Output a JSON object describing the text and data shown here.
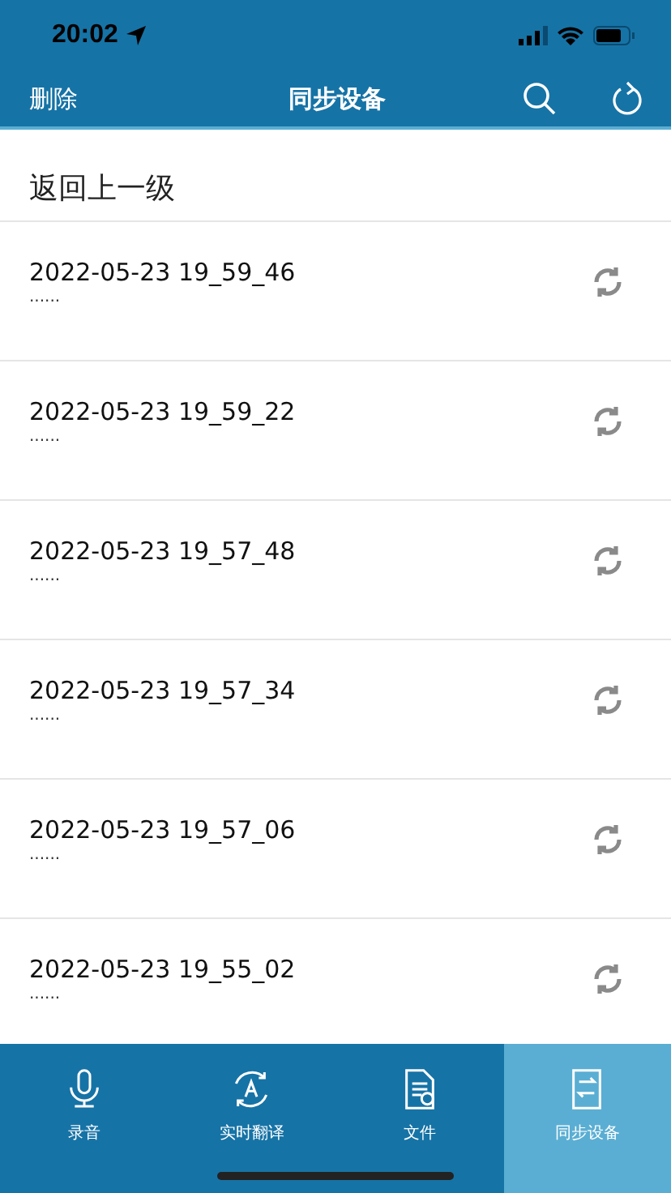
{
  "status_bar": {
    "time": "20:02"
  },
  "nav_bar": {
    "left_action": "删除",
    "title": "同步设备"
  },
  "back_link": "返回上一级",
  "recordings": [
    {
      "name": "2022-05-23 19_59_46",
      "detail": "......"
    },
    {
      "name": "2022-05-23 19_59_22",
      "detail": "......"
    },
    {
      "name": "2022-05-23 19_57_48",
      "detail": "......"
    },
    {
      "name": "2022-05-23 19_57_34",
      "detail": "......"
    },
    {
      "name": "2022-05-23 19_57_06",
      "detail": "......"
    },
    {
      "name": "2022-05-23 19_55_02",
      "detail": "......"
    }
  ],
  "tab_bar": [
    {
      "kind": "mic",
      "label": "录音",
      "selected": false
    },
    {
      "kind": "translate",
      "label": "实时翻译",
      "selected": false
    },
    {
      "kind": "file",
      "label": "文件",
      "selected": false
    },
    {
      "kind": "sync",
      "label": "同步设备",
      "selected": true
    }
  ]
}
